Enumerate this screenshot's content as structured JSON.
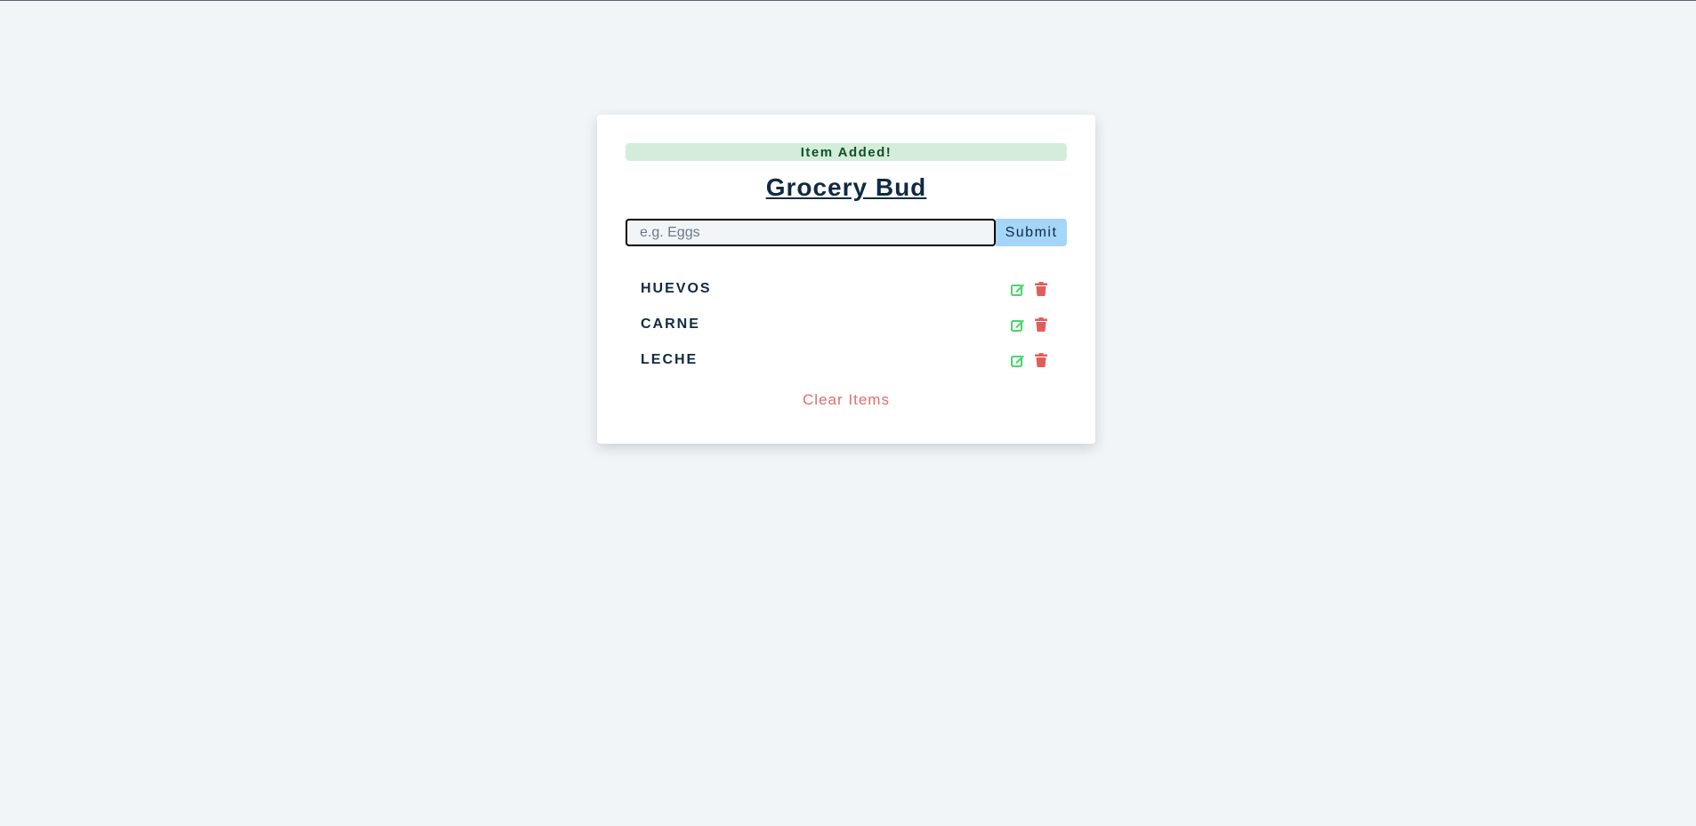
{
  "alert": {
    "text": "Item Added!"
  },
  "app": {
    "title": "Grocery Bud"
  },
  "form": {
    "input_value": "",
    "placeholder": "e.g. Eggs",
    "submit_label": "Submit"
  },
  "items": [
    {
      "name": "HUEVOS"
    },
    {
      "name": "CARNE"
    },
    {
      "name": "LECHE"
    }
  ],
  "clear_label": "Clear Items",
  "colors": {
    "background": "#f1f5f8",
    "alert_bg": "#d4eddb",
    "alert_text": "#0f5226",
    "title": "#102a42",
    "submit_bg": "#a5d5f8",
    "edit_icon": "#4bd56b",
    "delete_icon": "#e25c5c",
    "clear_text": "#e66b6b"
  },
  "icons": {
    "edit": "edit-icon",
    "delete": "trash-icon"
  }
}
